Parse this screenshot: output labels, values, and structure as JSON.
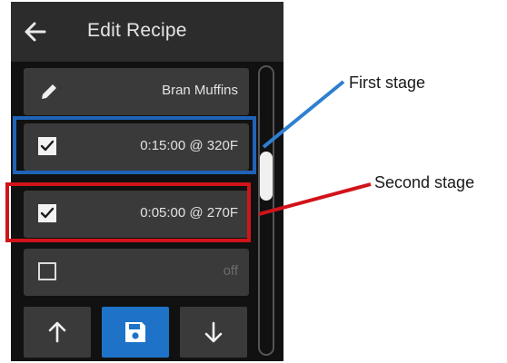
{
  "header": {
    "title": "Edit Recipe",
    "back_icon": "arrow-left-icon"
  },
  "recipe": {
    "name": "Bran Muffins",
    "edit_icon": "pencil-icon"
  },
  "stages": [
    {
      "label": "0:15:00 @ 320F",
      "checked": true
    },
    {
      "label": "0:05:00 @ 270F",
      "checked": true
    },
    {
      "label": "off",
      "checked": false
    }
  ],
  "toolbar": {
    "up_icon": "arrow-up-icon",
    "save_icon": "floppy-disk-icon",
    "down_icon": "arrow-down-icon"
  },
  "annotations": {
    "first": "First stage",
    "second": "Second stage"
  },
  "colors": {
    "save_accent": "#1e73c8",
    "first_stage_highlight": "#1f63b8",
    "second_stage_highlight": "#d1131a"
  }
}
